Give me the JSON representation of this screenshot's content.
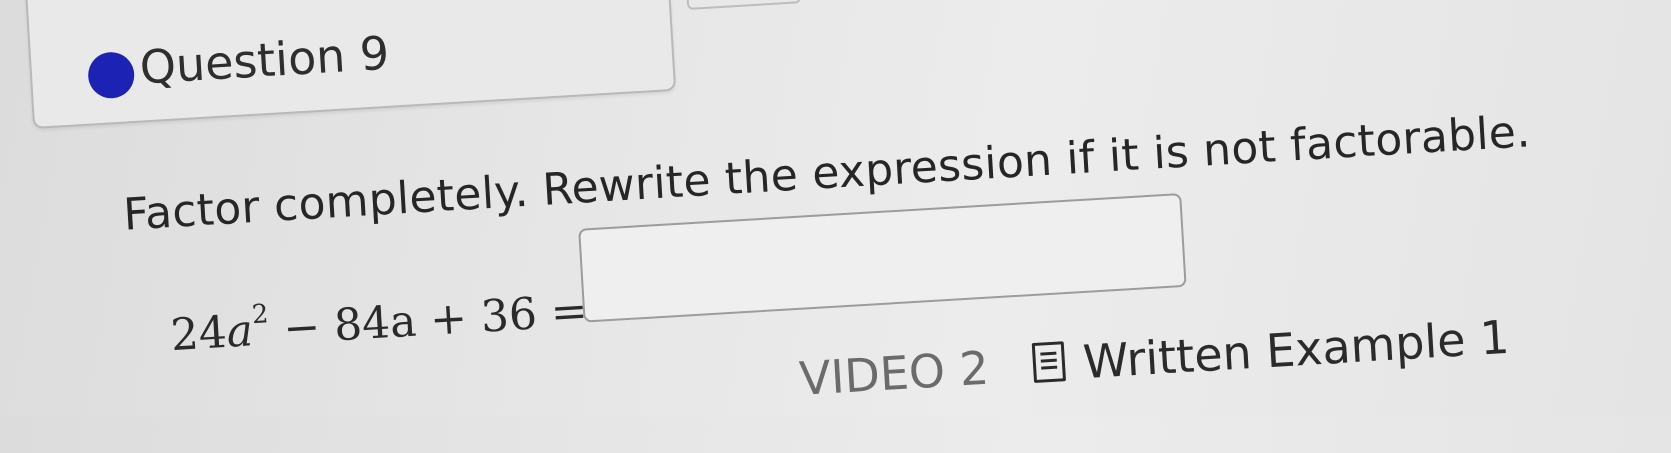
{
  "question": {
    "title": "Question 9",
    "dot_color": "#1c22b3"
  },
  "instruction": "Factor completely. Rewrite the expression if it is not factorable.",
  "expression": {
    "coef1": "24",
    "var1": "a",
    "exp1": "2",
    "op1": " − ",
    "term2": "84a",
    "op2": " + ",
    "term3": "36",
    "eq": " ="
  },
  "answer_input": {
    "value": ""
  },
  "links": {
    "video_label": "VIDEO 2",
    "written_example_label": "Written Example 1",
    "written_example_icon": "document-icon"
  }
}
